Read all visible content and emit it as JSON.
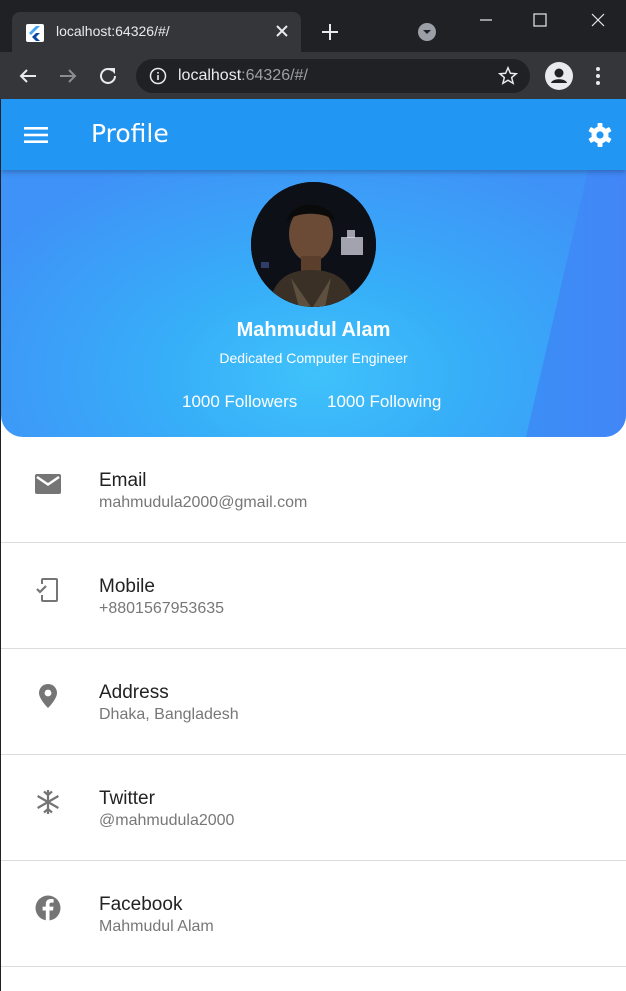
{
  "browser": {
    "tab_title": "localhost:64326/#/",
    "url_host": "localhost",
    "url_rest": ":64326/#/"
  },
  "appbar": {
    "title": "Profile"
  },
  "profile": {
    "name": "Mahmudul Alam",
    "tagline": "Dedicated Computer Engineer",
    "followers": "1000 Followers",
    "following": "1000 Following"
  },
  "contacts": [
    {
      "icon": "email-icon",
      "title": "Email",
      "value": "mahmudula2000@gmail.com"
    },
    {
      "icon": "mobile-icon",
      "title": "Mobile",
      "value": "+8801567953635"
    },
    {
      "icon": "location-icon",
      "title": "Address",
      "value": "Dhaka, Bangladesh"
    },
    {
      "icon": "snowflake-icon",
      "title": "Twitter",
      "value": "@mahmudula2000"
    },
    {
      "icon": "facebook-icon",
      "title": "Facebook",
      "value": "Mahmudul Alam"
    }
  ],
  "colors": {
    "appbar": "#2196f3",
    "hero_center": "#3fc2fb",
    "hero_edge": "#3f92f7",
    "icon_gray": "#757575"
  }
}
